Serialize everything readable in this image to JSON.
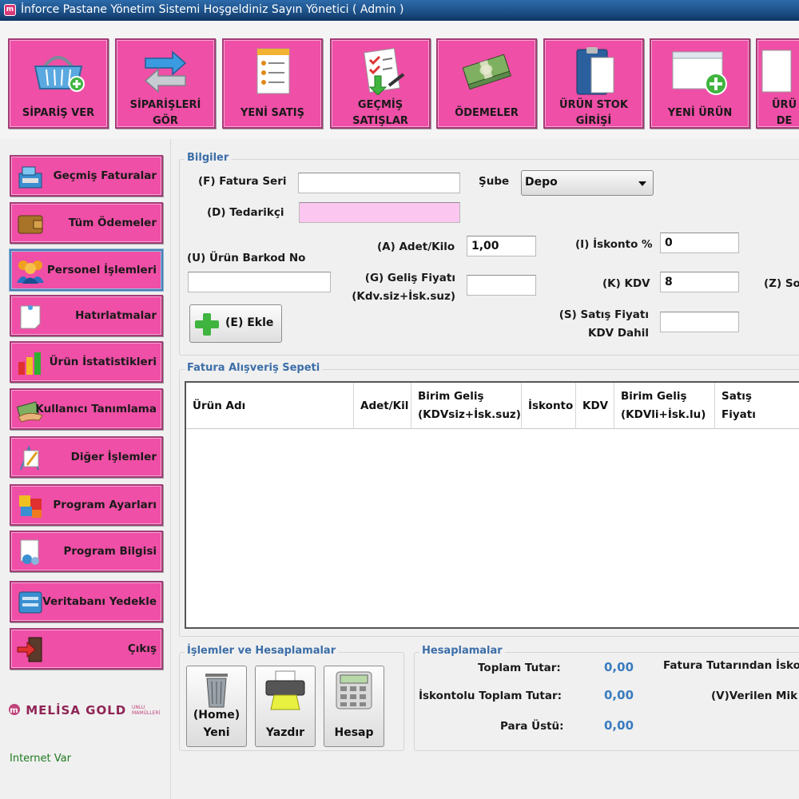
{
  "window": {
    "title": "İnforce Pastane Yönetim Sistemi Hoşgeldiniz Sayın Yönetici ( Admin )"
  },
  "toolbar": [
    {
      "label": "SİPARİŞ VER",
      "icon": "basket-icon"
    },
    {
      "label": "SİPARİŞLERİ\nGÖR",
      "icon": "arrows-swap-icon"
    },
    {
      "label": "YENİ SATIŞ",
      "icon": "receipt-icon"
    },
    {
      "label": "GEÇMİŞ\nSATIŞLAR",
      "icon": "checklist-icon"
    },
    {
      "label": "ÖDEMELER",
      "icon": "money-icon"
    },
    {
      "label": "ÜRÜN STOK\nGİRİŞİ",
      "icon": "clipboard-icon"
    },
    {
      "label": "YENİ ÜRÜN",
      "icon": "new-window-icon"
    },
    {
      "label": "ÜRÜ\nDE",
      "icon": "document-icon"
    }
  ],
  "sidebar": [
    {
      "label": "Geçmiş Faturalar",
      "icon": "cash-register-icon"
    },
    {
      "label": "Tüm Ödemeler",
      "icon": "wallet-icon"
    },
    {
      "label": "Personel İşlemleri",
      "icon": "people-icon"
    },
    {
      "label": "Hatırlatmalar",
      "icon": "note-icon"
    },
    {
      "label": "Ürün İstatistikleri",
      "icon": "bar-chart-icon"
    },
    {
      "label": "Kullanıcı Tanımlama",
      "icon": "handshake-icon"
    },
    {
      "label": "Diğer İşlemler",
      "icon": "drawing-icon"
    },
    {
      "label": "Program Ayarları",
      "icon": "settings-blocks-icon"
    },
    {
      "label": "Program Bilgisi",
      "icon": "info-icon"
    },
    {
      "label": "Veritabanı Yedekle",
      "icon": "database-icon"
    },
    {
      "label": "Çıkış",
      "icon": "exit-door-icon"
    }
  ],
  "brand": {
    "name": "MELİSA GOLD",
    "sub": "UNLU MAMÜLLERİ"
  },
  "status": {
    "internet": "Internet Var"
  },
  "form": {
    "section_title": "Bilgiler",
    "fatura_seri_label": "(F) Fatura Seri",
    "fatura_seri_value": "",
    "sube_label": "Şube",
    "sube_value": "Depo",
    "tedarikci_label": "(D) Tedarikçi",
    "tedarikci_value": "",
    "barkod_label": "(U) Ürün Barkod No",
    "barkod_value": "",
    "adet_label": "(A) Adet/Kilo",
    "adet_value": "1,00",
    "gelis_label_1": "(G) Geliş Fiyatı",
    "gelis_label_2": "(Kdv.siz+İsk.suz)",
    "gelis_value": "",
    "iskonto_label": "(I) İskonto %",
    "iskonto_value": "0",
    "kdv_label": "(K) KDV",
    "kdv_value": "8",
    "z_label": "(Z) So",
    "satis_label_1": "(S) Satış Fiyatı",
    "satis_label_2": "KDV Dahil",
    "satis_value": "",
    "ekle_label": "(E) Ekle"
  },
  "cart": {
    "title": "Fatura Alışveriş Sepeti",
    "columns": [
      "Ürün Adı",
      "Adet/Kil",
      "Birim Geliş\n(KDVsiz+İsk.suz)",
      "İskonto",
      "KDV",
      "Birim Geliş\n(KDVli+İsk.lu)",
      "Satış\nFiyatı"
    ],
    "rows": []
  },
  "actions": {
    "title": "İşlemler ve Hesaplamalar",
    "buttons": [
      {
        "label": "(Home)\nYeni",
        "icon": "trash-bin-icon"
      },
      {
        "label": "Yazdır",
        "icon": "printer-icon"
      },
      {
        "label": "Hesap",
        "icon": "calculator-icon"
      }
    ]
  },
  "calc": {
    "title": "Hesaplamalar",
    "toplam_label": "Toplam Tutar:",
    "toplam_value": "0,00",
    "iskontolu_label": "İskontolu Toplam Tutar:",
    "iskontolu_value": "0,00",
    "para_label": "Para Üstü:",
    "para_value": "0,00",
    "fatura_iskonto_label": "Fatura Tutarından İsko",
    "verilen_label": "(V)Verilen Mik"
  }
}
